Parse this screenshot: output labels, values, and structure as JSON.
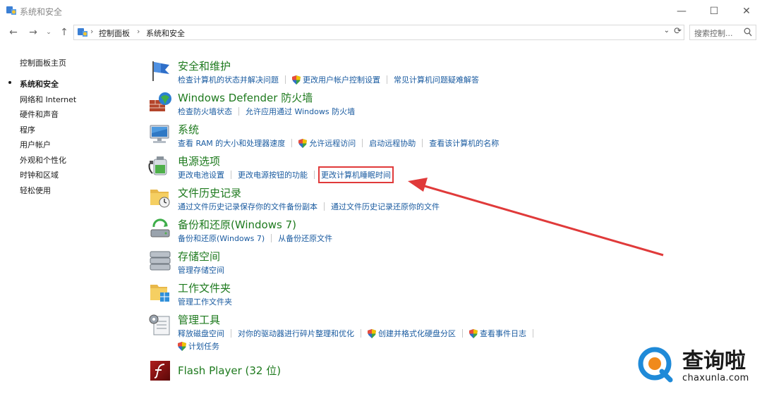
{
  "window": {
    "title": "系统和安全"
  },
  "titlebar_buttons": {
    "minimize": "—",
    "maximize": "☐",
    "close": "✕"
  },
  "nav": {
    "back": "←",
    "forward": "→",
    "recent": "⌄",
    "up": "↑",
    "breadcrumb": [
      "控制面板",
      "系统和安全"
    ],
    "crumb_sep": "›",
    "dropdown": "⌄",
    "refresh": "⟳",
    "search_placeholder": "搜索控制..."
  },
  "sidebar": {
    "home": "控制面板主页",
    "items": [
      "系统和安全",
      "网络和 Internet",
      "硬件和声音",
      "程序",
      "用户帐户",
      "外观和个性化",
      "时钟和区域",
      "轻松使用"
    ],
    "active_index": 0
  },
  "categories": [
    {
      "title": "安全和维护",
      "icon": "flag-icon",
      "links": [
        {
          "label": "检查计算机的状态并解决问题",
          "shield": false
        },
        {
          "label": "更改用户帐户控制设置",
          "shield": true
        },
        {
          "label": "常见计算机问题疑难解答",
          "shield": false
        }
      ]
    },
    {
      "title": "Windows Defender 防火墙",
      "icon": "firewall-icon",
      "links": [
        {
          "label": "检查防火墙状态",
          "shield": false
        },
        {
          "label": "允许应用通过 Windows 防火墙",
          "shield": false
        }
      ]
    },
    {
      "title": "系统",
      "icon": "computer-icon",
      "links": [
        {
          "label": "查看 RAM 的大小和处理器速度",
          "shield": false
        },
        {
          "label": "允许远程访问",
          "shield": true
        },
        {
          "label": "启动远程协助",
          "shield": false
        },
        {
          "label": "查看该计算机的名称",
          "shield": false
        }
      ]
    },
    {
      "title": "电源选项",
      "icon": "power-options-icon",
      "links": [
        {
          "label": "更改电池设置",
          "shield": false
        },
        {
          "label": "更改电源按钮的功能",
          "shield": false
        },
        {
          "label": "更改计算机睡眠时间",
          "shield": false,
          "highlight": true
        }
      ]
    },
    {
      "title": "文件历史记录",
      "icon": "file-history-icon",
      "links": [
        {
          "label": "通过文件历史记录保存你的文件备份副本",
          "shield": false
        },
        {
          "label": "通过文件历史记录还原你的文件",
          "shield": false
        }
      ]
    },
    {
      "title": "备份和还原(Windows 7)",
      "icon": "backup-icon",
      "links": [
        {
          "label": "备份和还原(Windows 7)",
          "shield": false
        },
        {
          "label": "从备份还原文件",
          "shield": false
        }
      ]
    },
    {
      "title": "存储空间",
      "icon": "storage-icon",
      "links": [
        {
          "label": "管理存储空间",
          "shield": false
        }
      ]
    },
    {
      "title": "工作文件夹",
      "icon": "work-folders-icon",
      "links": [
        {
          "label": "管理工作文件夹",
          "shield": false
        }
      ]
    },
    {
      "title": "管理工具",
      "icon": "admin-tools-icon",
      "links": [
        {
          "label": "释放磁盘空间",
          "shield": false
        },
        {
          "label": "对你的驱动器进行碎片整理和优化",
          "shield": false
        },
        {
          "label": "创建并格式化硬盘分区",
          "shield": true
        },
        {
          "label": "查看事件日志",
          "shield": true
        }
      ],
      "links2": [
        {
          "label": "计划任务",
          "shield": true
        }
      ]
    },
    {
      "title": "Flash Player (32 位)",
      "icon": "flash-player-icon",
      "links": []
    }
  ],
  "watermark": {
    "name": "查询啦",
    "url": "chaxunla.com"
  },
  "colors": {
    "accent_title": "#1e7a1e",
    "link": "#1a5ba0",
    "annotation": "#e03a3a"
  }
}
